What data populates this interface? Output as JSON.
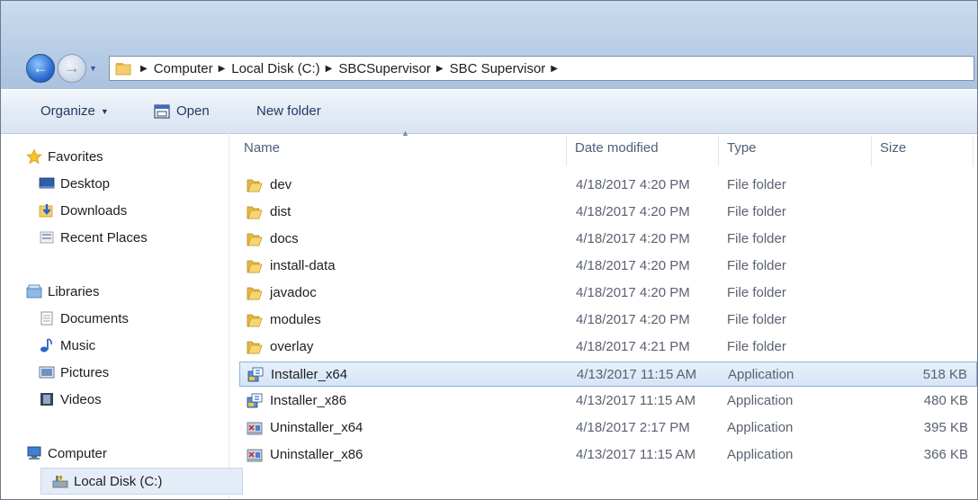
{
  "address": {
    "crumbs": [
      "Computer",
      "Local Disk (C:)",
      "SBCSupervisor",
      "SBC Supervisor"
    ]
  },
  "toolbar": {
    "organize": "Organize",
    "open": "Open",
    "new_folder": "New folder"
  },
  "sidebar": {
    "favorites": "Favorites",
    "desktop": "Desktop",
    "downloads": "Downloads",
    "recent": "Recent Places",
    "libraries": "Libraries",
    "documents": "Documents",
    "music": "Music",
    "pictures": "Pictures",
    "videos": "Videos",
    "computer": "Computer",
    "local_disk": "Local Disk (C:)"
  },
  "columns": {
    "name": "Name",
    "date": "Date modified",
    "type": "Type",
    "size": "Size"
  },
  "files": [
    {
      "name": "dev",
      "date": "4/18/2017 4:20 PM",
      "type": "File folder",
      "size": "",
      "icon": "folder"
    },
    {
      "name": "dist",
      "date": "4/18/2017 4:20 PM",
      "type": "File folder",
      "size": "",
      "icon": "folder"
    },
    {
      "name": "docs",
      "date": "4/18/2017 4:20 PM",
      "type": "File folder",
      "size": "",
      "icon": "folder"
    },
    {
      "name": "install-data",
      "date": "4/18/2017 4:20 PM",
      "type": "File folder",
      "size": "",
      "icon": "folder"
    },
    {
      "name": "javadoc",
      "date": "4/18/2017 4:20 PM",
      "type": "File folder",
      "size": "",
      "icon": "folder"
    },
    {
      "name": "modules",
      "date": "4/18/2017 4:20 PM",
      "type": "File folder",
      "size": "",
      "icon": "folder"
    },
    {
      "name": "overlay",
      "date": "4/18/2017 4:21 PM",
      "type": "File folder",
      "size": "",
      "icon": "folder"
    },
    {
      "name": "Installer_x64",
      "date": "4/13/2017 11:15 AM",
      "type": "Application",
      "size": "518 KB",
      "icon": "installer"
    },
    {
      "name": "Installer_x86",
      "date": "4/13/2017 11:15 AM",
      "type": "Application",
      "size": "480 KB",
      "icon": "installer"
    },
    {
      "name": "Uninstaller_x64",
      "date": "4/18/2017 2:17 PM",
      "type": "Application",
      "size": "395 KB",
      "icon": "uninstaller"
    },
    {
      "name": "Uninstaller_x86",
      "date": "4/13/2017 11:15 AM",
      "type": "Application",
      "size": "366 KB",
      "icon": "uninstaller"
    }
  ]
}
